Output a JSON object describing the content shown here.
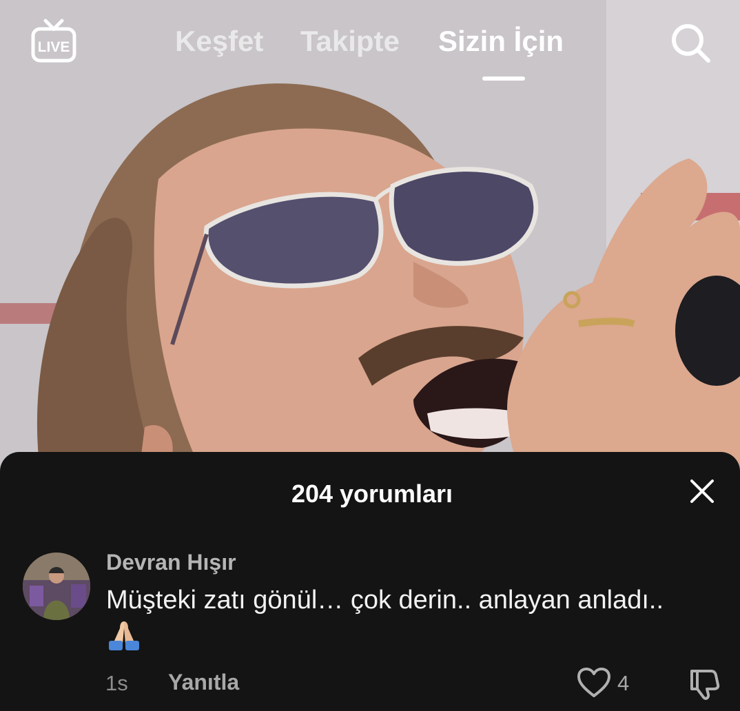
{
  "nav": {
    "live_label": "LIVE",
    "tabs": [
      {
        "label": "Keşfet",
        "active": false
      },
      {
        "label": "Takipte",
        "active": false
      },
      {
        "label": "Sizin İçin",
        "active": true
      }
    ],
    "icons": {
      "live": "live-tv-icon",
      "search": "search-icon"
    }
  },
  "comments": {
    "title": "204 yorumları",
    "close_icon": "close-icon",
    "items": [
      {
        "username": "Devran Hışır",
        "text": "Müşteki zatı gönül… çok derin.. anlayan anladı..",
        "emoji": "🙏🏼",
        "time": "1s",
        "reply_label": "Yanıtla",
        "like_count": "4",
        "like_icon": "heart-icon",
        "dislike_icon": "thumbs-down-icon"
      }
    ]
  },
  "colors": {
    "sheet_background": "#141414",
    "active_tab": "#ffffff",
    "inactive_tab": "#e6e6e6",
    "secondary_text": "#a8a8a8"
  }
}
